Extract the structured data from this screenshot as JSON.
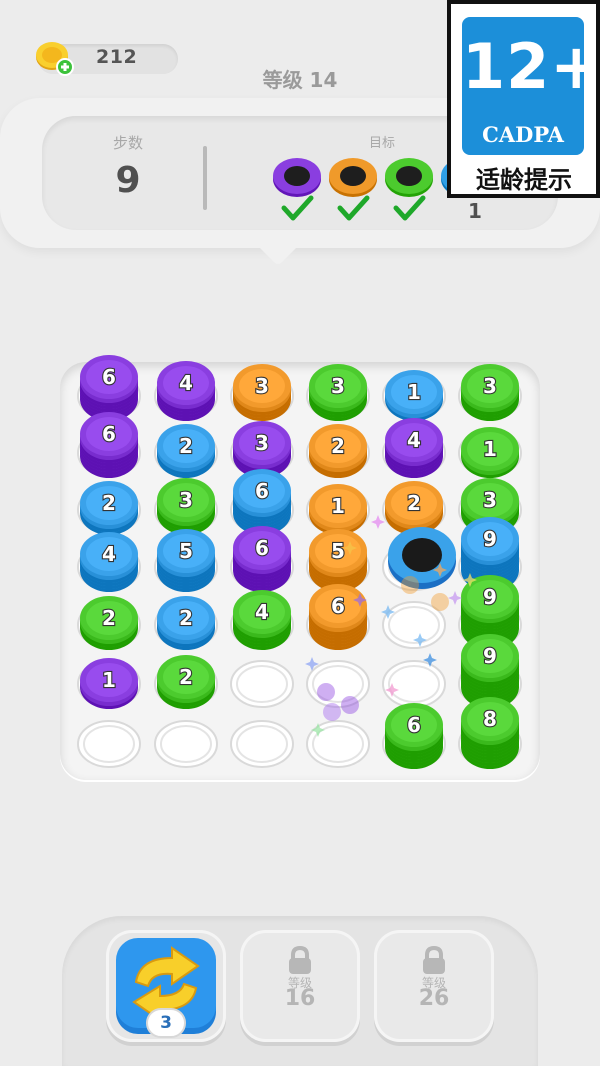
{
  "header": {
    "coins": "212",
    "level_title": "等级 14"
  },
  "goal_panel": {
    "steps_label": "步数",
    "steps_value": "9",
    "target_label": "目标",
    "targets": [
      {
        "color": "#8a3ee0",
        "done": true
      },
      {
        "color": "#f09a2a",
        "done": true
      },
      {
        "color": "#4ccb2e",
        "done": true
      },
      {
        "color": "#2f9fe6",
        "done": false,
        "remaining": "1"
      }
    ]
  },
  "age_rating": {
    "rating": "12+",
    "org": "CADPA",
    "tip": "适龄提示"
  },
  "colors": {
    "purple": "#8a3ee0",
    "blue": "#3aa2ea",
    "orange": "#f29a2c",
    "green": "#4ccb2e",
    "check": "#1fa82a"
  },
  "board": {
    "rows": [
      [
        {
          "c": "purple",
          "n": "6"
        },
        {
          "c": "purple",
          "n": "4"
        },
        {
          "c": "orange",
          "n": "3"
        },
        {
          "c": "green",
          "n": "3"
        },
        {
          "c": "blue",
          "n": "1"
        },
        {
          "c": "green",
          "n": "3"
        }
      ],
      [
        {
          "c": "purple",
          "n": "6"
        },
        {
          "c": "blue",
          "n": "2"
        },
        {
          "c": "purple",
          "n": "3"
        },
        {
          "c": "orange",
          "n": "2"
        },
        {
          "c": "purple",
          "n": "4"
        },
        {
          "c": "green",
          "n": "1"
        }
      ],
      [
        {
          "c": "blue",
          "n": "2"
        },
        {
          "c": "green",
          "n": "3"
        },
        {
          "c": "blue",
          "n": "6"
        },
        {
          "c": "orange",
          "n": "1"
        },
        {
          "c": "orange",
          "n": "2"
        },
        {
          "c": "green",
          "n": "3"
        }
      ],
      [
        {
          "c": "blue",
          "n": "4"
        },
        {
          "c": "blue",
          "n": "5"
        },
        {
          "c": "purple",
          "n": "6"
        },
        {
          "c": "orange",
          "n": "5"
        },
        {
          "c": "hole",
          "n": ""
        },
        {
          "c": "blue",
          "n": "9"
        }
      ],
      [
        {
          "c": "green",
          "n": "2"
        },
        {
          "c": "blue",
          "n": "2"
        },
        {
          "c": "green",
          "n": "4"
        },
        {
          "c": "orange",
          "n": "6"
        },
        {
          "c": "empty",
          "n": ""
        },
        {
          "c": "green",
          "n": "9"
        }
      ],
      [
        {
          "c": "purple",
          "n": "1"
        },
        {
          "c": "green",
          "n": "2"
        },
        {
          "c": "empty",
          "n": ""
        },
        {
          "c": "empty",
          "n": ""
        },
        {
          "c": "empty",
          "n": ""
        },
        {
          "c": "green",
          "n": "9"
        }
      ],
      [
        {
          "c": "empty",
          "n": ""
        },
        {
          "c": "empty",
          "n": ""
        },
        {
          "c": "empty",
          "n": ""
        },
        {
          "c": "empty",
          "n": ""
        },
        {
          "c": "green",
          "n": "6"
        },
        {
          "c": "green",
          "n": "8"
        }
      ]
    ]
  },
  "boosters": {
    "shuffle": {
      "count": "3",
      "icon": "shuffle-arrows-icon"
    },
    "locked": [
      {
        "label": "等级",
        "level": "16",
        "icon": "lock-icon"
      },
      {
        "label": "等级",
        "level": "26",
        "icon": "lock-icon"
      }
    ]
  }
}
